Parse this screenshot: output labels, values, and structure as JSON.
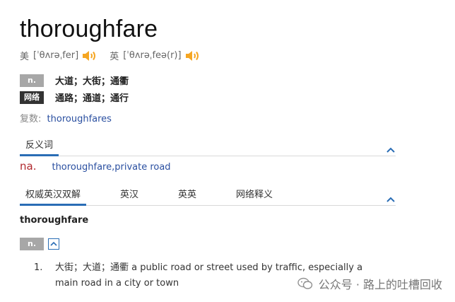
{
  "word": "thoroughfare",
  "pronunciations": [
    {
      "label": "美",
      "ipa": "[ˈθʌrəˌfer]",
      "icon": "speaker-icon"
    },
    {
      "label": "英",
      "ipa": "[ˈθʌrəˌfeə(r)]",
      "icon": "speaker-icon"
    }
  ],
  "definitions": [
    {
      "badge": "n.",
      "text": "大道；大街；通衢"
    },
    {
      "badge": "网络",
      "text": "通路；通道；通行"
    }
  ],
  "plural": {
    "label": "复数:",
    "value": "thoroughfares"
  },
  "antonym_section": {
    "tab": "反义词",
    "pos": "na.",
    "value": "thoroughfare,private road"
  },
  "dict_tabs": [
    "权威英汉双解",
    "英汉",
    "英英",
    "网络释义"
  ],
  "authority": {
    "headword": "thoroughfare",
    "pos": "n.",
    "sense_number": "1.",
    "sense_text": "大街；大道；通衢 a public road or street used by traffic, especially a main road in a city or town"
  },
  "watermark": "公众号 · 路上的吐槽回收",
  "colors": {
    "accent": "#2a6db5",
    "link": "#2a4fa0",
    "speaker": "#f5a623",
    "pos_red": "#b0282d"
  }
}
